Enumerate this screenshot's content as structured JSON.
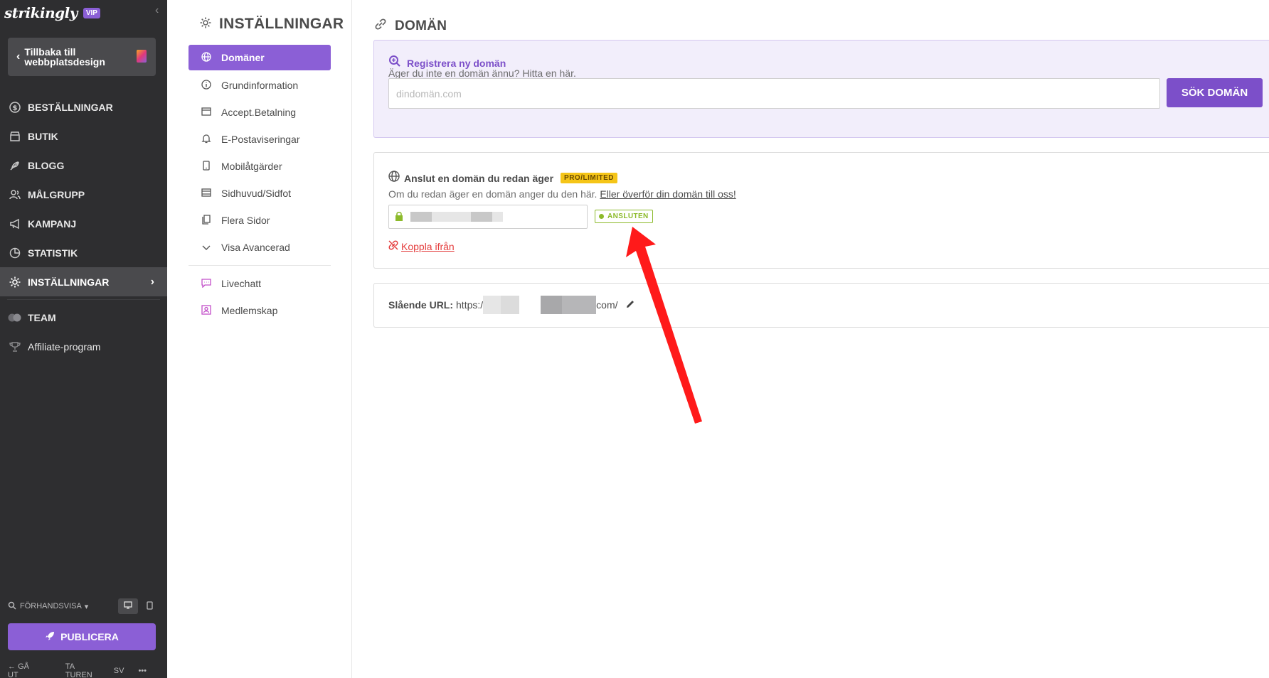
{
  "sidebar": {
    "logo": "strikingly",
    "vip": "VIP",
    "back_label": "Tillbaka till webbplatsdesign",
    "items": [
      {
        "label": "BESTÄLLNINGAR",
        "icon": "dollar-circle-icon"
      },
      {
        "label": "BUTIK",
        "icon": "store-icon"
      },
      {
        "label": "BLOGG",
        "icon": "feather-icon"
      },
      {
        "label": "MÅLGRUPP",
        "icon": "users-icon"
      },
      {
        "label": "KAMPANJ",
        "icon": "megaphone-icon"
      },
      {
        "label": "STATISTIK",
        "icon": "pie-chart-icon"
      },
      {
        "label": "INSTÄLLNINGAR",
        "icon": "gear-icon",
        "active": true
      },
      {
        "label": "TEAM",
        "icon": "team-icon"
      },
      {
        "label": "Affiliate-program",
        "icon": "trophy-icon"
      }
    ],
    "preview_label": "FÖRHANDSVISA",
    "publish_label": "PUBLICERA",
    "footer": {
      "exit": "GÅ UT",
      "tour": "TA TUREN",
      "lang": "SV",
      "more": "•••"
    }
  },
  "settings": {
    "title": "INSTÄLLNINGAR",
    "items": [
      {
        "label": "Domäner",
        "icon": "globe-icon",
        "active": true
      },
      {
        "label": "Grundinformation",
        "icon": "info-icon"
      },
      {
        "label": "Accept.Betalning",
        "icon": "payment-icon"
      },
      {
        "label": "E-Postaviseringar",
        "icon": "bell-icon"
      },
      {
        "label": "Mobilåtgärder",
        "icon": "mobile-icon"
      },
      {
        "label": "Sidhuvud/Sidfot",
        "icon": "layout-icon"
      },
      {
        "label": "Flera Sidor",
        "icon": "pages-icon"
      },
      {
        "label": "Visa Avancerad",
        "icon": "chevron-down-icon"
      }
    ],
    "extras": [
      {
        "label": "Livechatt",
        "icon": "chat-icon"
      },
      {
        "label": "Medlemskap",
        "icon": "member-icon"
      }
    ]
  },
  "main": {
    "title": "DOMÄN",
    "register": {
      "title": "Registrera ny domän",
      "desc": "Äger du inte en domän ännu? Hitta en här.",
      "placeholder": "dindomän.com",
      "button": "SÖK DOMÄN"
    },
    "connect": {
      "title": "Anslut en domän du redan äger",
      "badge": "PRO/LIMITED",
      "desc": "Om du redan äger en domän anger du den här.",
      "link": "Eller överför din domän till oss!",
      "status": "ANSLUTEN",
      "disconnect": "Koppla ifrån"
    },
    "url": {
      "label": "Slående URL:",
      "prefix": "https:/",
      "suffix": "com/"
    }
  },
  "colors": {
    "accent": "#8b5fd6",
    "sidebar_bg": "#2e2e30",
    "connected": "#8cba2a",
    "danger": "#e43d3d",
    "annotation_arrow": "#ff1a1a"
  }
}
